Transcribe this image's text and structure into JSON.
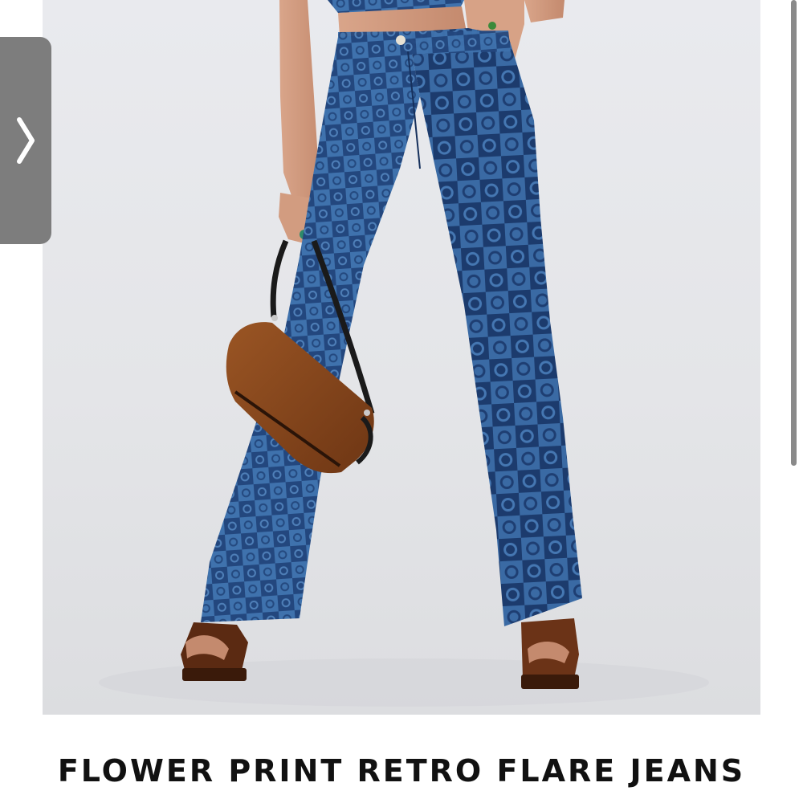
{
  "product": {
    "title": "FLOWER PRINT RETRO FLARE JEANS",
    "image_alt": "model-wearing-checkered-flower-print-flare-jeans"
  },
  "carousel": {
    "next_icon": "chevron-right-icon"
  },
  "colors": {
    "background": "#ffffff",
    "photo_backdrop": "#e6e7ea",
    "denim_dark": "#1e3f73",
    "denim_light": "#3d6ea8",
    "bag_brown": "#8a4a1e",
    "carousel_button": "#7d7d7d",
    "title_text": "#111111"
  }
}
